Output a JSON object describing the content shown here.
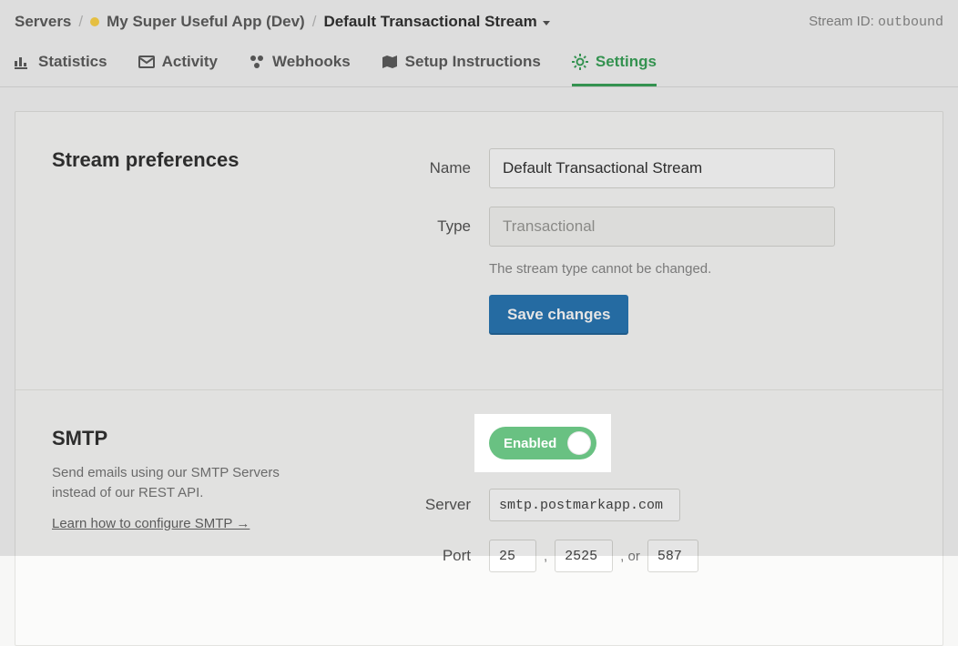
{
  "breadcrumb": {
    "root": "Servers",
    "server": "My Super Useful App (Dev)",
    "stream": "Default Transactional Stream"
  },
  "stream_id": {
    "label": "Stream ID:",
    "value": "outbound"
  },
  "tabs": {
    "statistics": "Statistics",
    "activity": "Activity",
    "webhooks": "Webhooks",
    "setup": "Setup Instructions",
    "settings": "Settings"
  },
  "preferences": {
    "heading": "Stream preferences",
    "name_label": "Name",
    "name_value": "Default Transactional Stream",
    "type_label": "Type",
    "type_value": "Transactional",
    "type_help": "The stream type cannot be changed.",
    "save_label": "Save changes"
  },
  "smtp": {
    "heading": "SMTP",
    "description": "Send emails using our SMTP Servers instead of our REST API.",
    "learn_link": "Learn how to configure SMTP →",
    "toggle_label": "Enabled",
    "server_label": "Server",
    "server_value": "smtp.postmarkapp.com",
    "port_label": "Port",
    "ports": [
      "25",
      "2525",
      "587"
    ],
    "port_sep1": ",",
    "port_sep2": ", or"
  }
}
